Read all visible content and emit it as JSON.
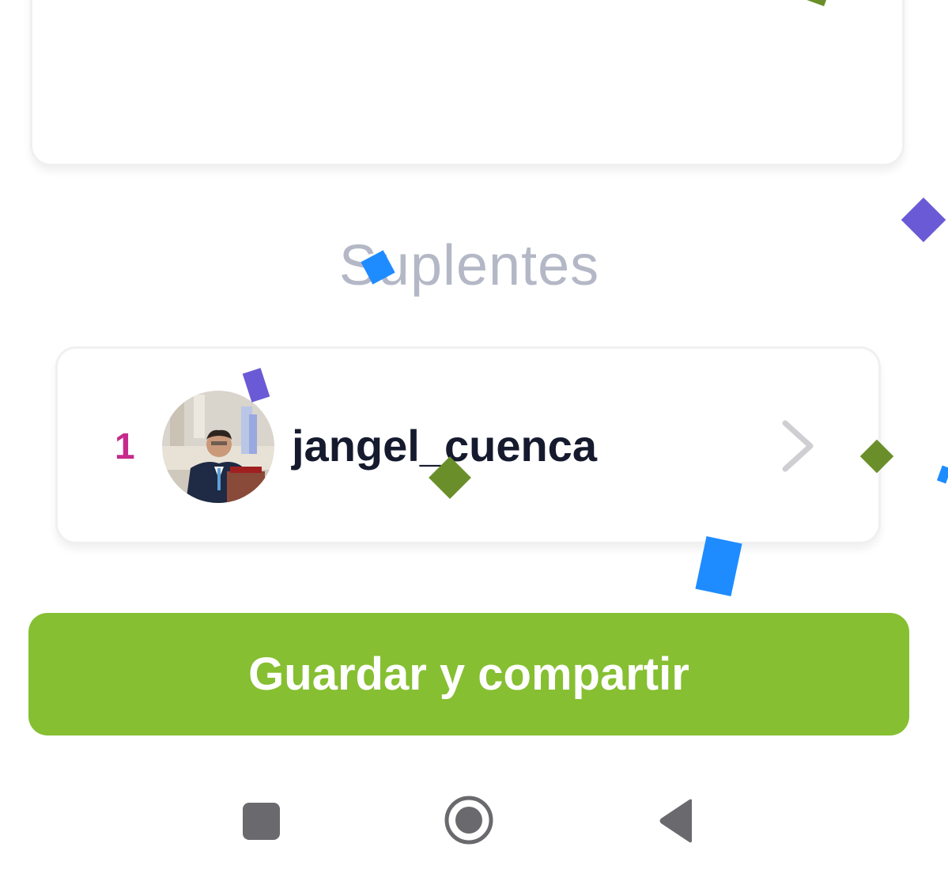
{
  "section": {
    "title": "Suplentes"
  },
  "substitutes": [
    {
      "rank": "1",
      "username": "jangel_cuenca",
      "avatar": "user-photo"
    }
  ],
  "actions": {
    "save_share_label": "Guardar y compartir"
  },
  "navbar": {
    "recent_icon": "square-icon",
    "home_icon": "circle-icon",
    "back_icon": "triangle-back-icon"
  },
  "colors": {
    "primary_button": "#86bf32",
    "rank_color": "#c62a8d",
    "username_color": "#161a2e",
    "title_color": "#b4b8c6",
    "confetti_blue": "#1e8cff",
    "confetti_purple": "#6a5ad6",
    "confetti_green": "#6a8f2a"
  }
}
